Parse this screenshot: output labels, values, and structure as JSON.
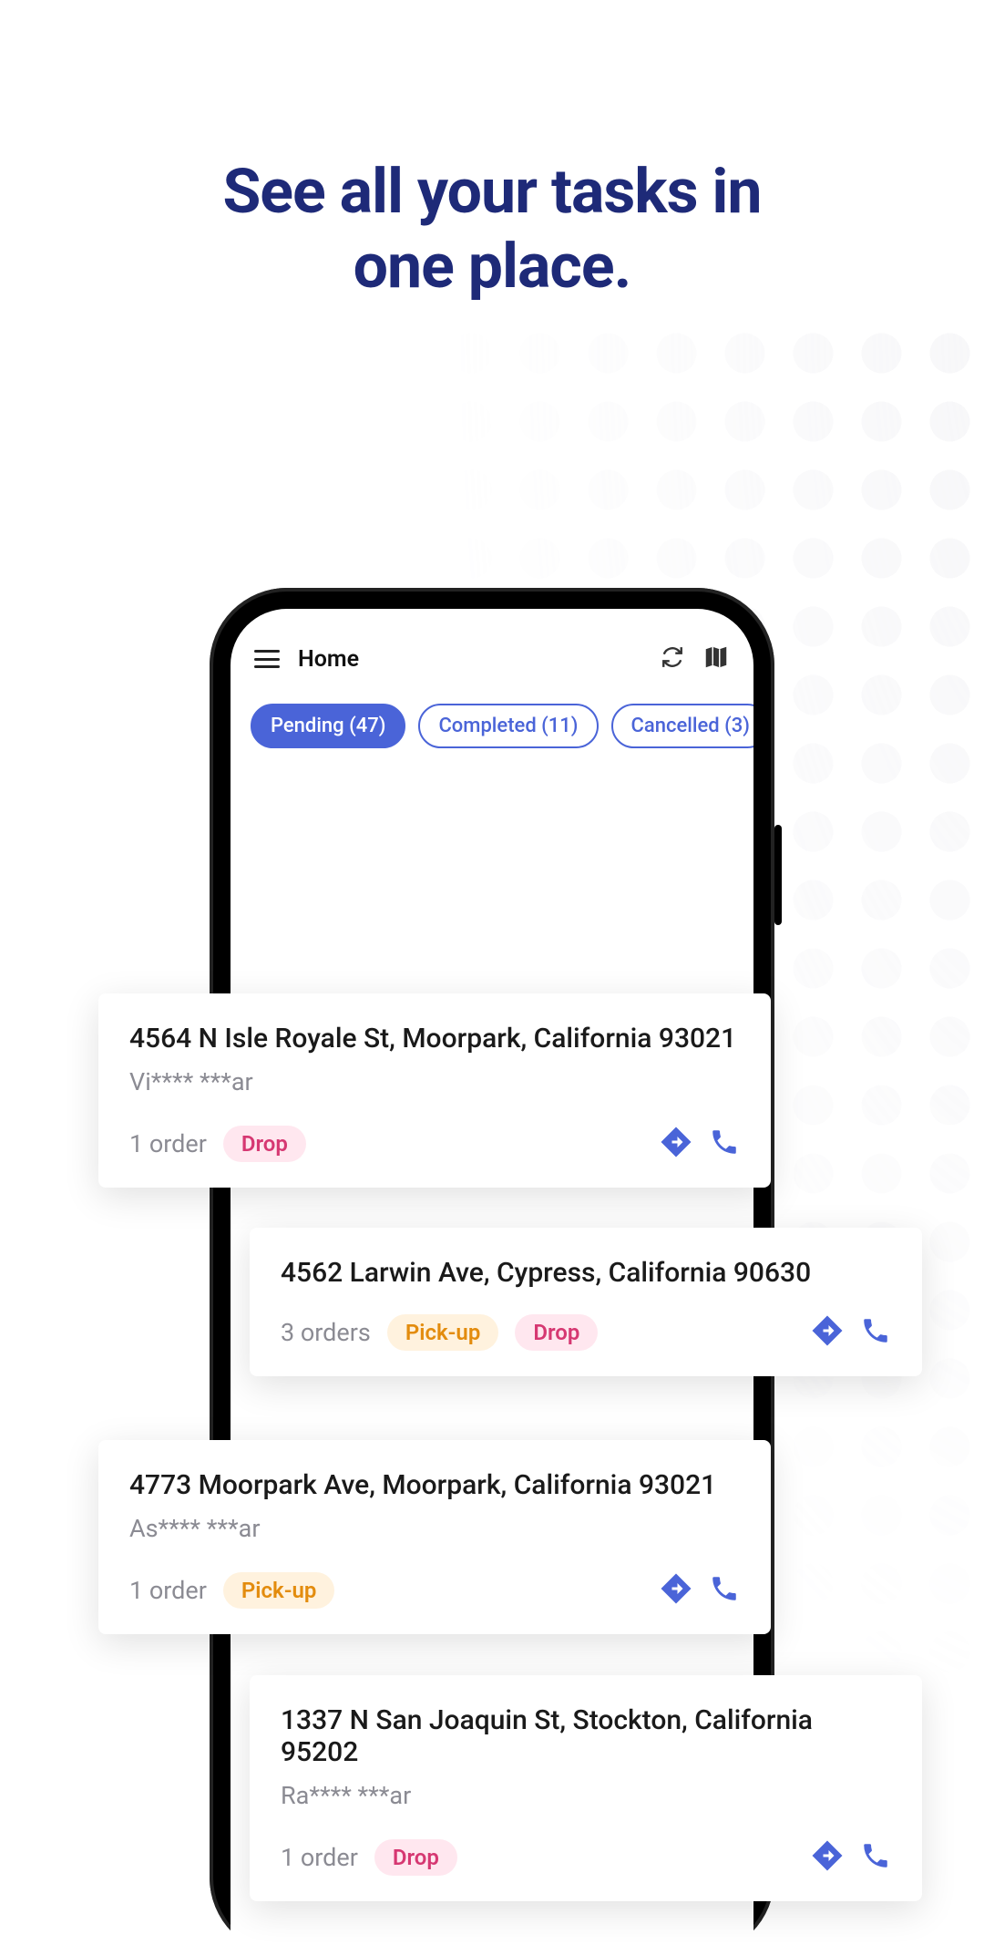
{
  "hero": {
    "line1": "See all your tasks in",
    "line2": "one place."
  },
  "header": {
    "title": "Home",
    "icons": [
      "refresh-icon",
      "map-icon"
    ]
  },
  "filters": [
    {
      "label": "Pending (47)",
      "active": true
    },
    {
      "label": "Completed (11)",
      "active": false
    },
    {
      "label": "Cancelled (3)",
      "active": false
    }
  ],
  "tasks": [
    {
      "address": "4564 N Isle Royale St, Moorpark, California 93021",
      "customer": "Vi**** ***ar",
      "order_count": "1 order",
      "tags": [
        {
          "type": "drop",
          "label": "Drop"
        }
      ]
    },
    {
      "address": "4562 Larwin Ave, Cypress, California 90630",
      "customer": "",
      "order_count": "3 orders",
      "tags": [
        {
          "type": "pickup",
          "label": "Pick-up"
        },
        {
          "type": "drop",
          "label": "Drop"
        }
      ]
    },
    {
      "address": "4773 Moorpark Ave, Moorpark, California 93021",
      "customer": "As**** ***ar",
      "order_count": "1 order",
      "tags": [
        {
          "type": "pickup",
          "label": "Pick-up"
        }
      ]
    },
    {
      "address": "1337 N San Joaquin St, Stockton, California 95202",
      "customer": "Ra**** ***ar",
      "order_count": "1 order",
      "tags": [
        {
          "type": "drop",
          "label": "Drop"
        }
      ]
    }
  ],
  "colors": {
    "primary": "#4a64d8",
    "hero_text": "#1e2a78",
    "pickup_bg": "#fff2de",
    "pickup_fg": "#e38c0e",
    "drop_bg": "#ffe7ef",
    "drop_fg": "#d63872"
  }
}
